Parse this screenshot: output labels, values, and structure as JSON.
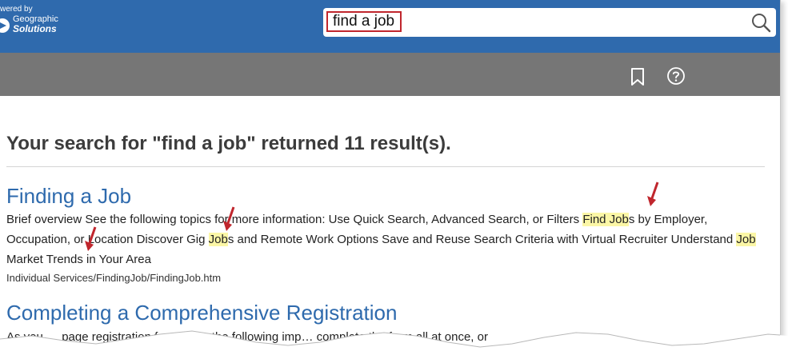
{
  "header": {
    "logo_powered_by": "wered by",
    "logo_line1": "Geographic",
    "logo_line2": "Solutions",
    "search_value": "find a job"
  },
  "toolbar": {
    "bookmark_icon": "bookmark-icon",
    "help_icon": "help-icon"
  },
  "results": {
    "summary": "Your search for \"find a job\" returned 11 result(s).",
    "items": [
      {
        "title": "Finding a Job",
        "text_parts": [
          "Brief overview   See the following topics for more information: Use Quick Search, Advanced Search, or Filters ",
          "Find Job",
          "s by Employer, Occupation, or Location Discover Gig ",
          "Job",
          "s and Remote Work Options Save and Reuse Search Criteria with Virtual Recruiter Understand ",
          "Job",
          " Market Trends in Your Area"
        ],
        "path": "Individual Services/FindingJob/FindingJob.htm"
      },
      {
        "title": "Completing a Comprehensive Registration",
        "text_visible": "As you … page registration form, note the following imp… complete the form all at once, or"
      }
    ]
  },
  "colors": {
    "header_bg": "#2f6aad",
    "toolbar_bg": "#767676",
    "link": "#2e6aad",
    "highlight": "#fbf6a6",
    "callout_red": "#c0262d"
  }
}
